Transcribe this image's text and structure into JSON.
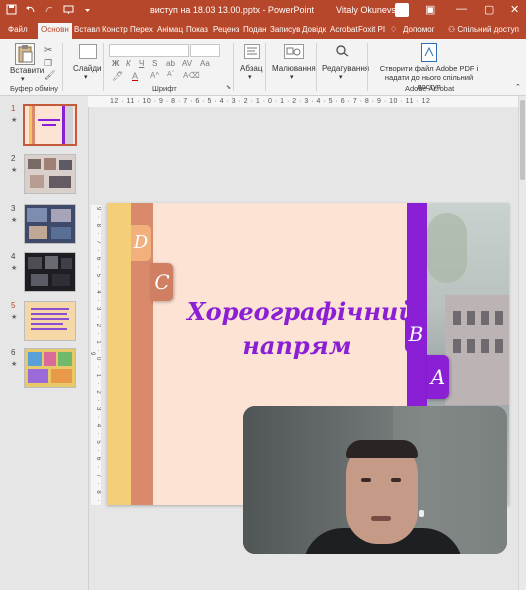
{
  "titlebar": {
    "document_title": "виступ на 18.03 13.00.pptx  -  PowerPoint",
    "user_name": "Vitaly Okunevsky"
  },
  "tabs": [
    "Файл",
    "Основн",
    "Вставл",
    "Констр",
    "Перех",
    "Анімац",
    "Показ",
    "Реценз",
    "Подан",
    "Записув",
    "Довідк",
    "Acrobat",
    "Foxit PI",
    "Допомог"
  ],
  "share": "Спільний доступ",
  "ribbon": {
    "paste": "Вставити",
    "clipboard_group": "Буфер обміну",
    "slides": "Слайди",
    "font_group": "Шрифт",
    "paragraph": "Абзац",
    "drawing": "Малювання",
    "editing": "Редагування",
    "acrobat_action_line1": "Створити файл Adobe PDF і",
    "acrobat_action_line2": "надати до нього спільний доступ",
    "acrobat_group": "Adobe Acrobat"
  },
  "ruler": {
    "top": "12 · 11 · 10 · 9 · 8 · 7 · 6 · 5 · 4 · 3 · 2 · 1 · 0 · 1 · 2 · 3 · 4 · 5 · 6 · 7 · 8 · 9 · 10 · 11 · 12",
    "left": "9 · 8 · 7 · 6 · 5 · 4 · 3 · 2 · 1 · 0 · 1 · 2 · 3 · 4 · 5 · 6 · 7 · 8 · 9"
  },
  "thumbnails": [
    {
      "num": "1",
      "selected": true
    },
    {
      "num": "2",
      "selected": false
    },
    {
      "num": "3",
      "selected": false
    },
    {
      "num": "4",
      "selected": false
    },
    {
      "num": "5",
      "selected": false
    },
    {
      "num": "6",
      "selected": false
    }
  ],
  "slide": {
    "title_line1": "Хореографічний",
    "title_line2": "напрям",
    "tab_letter_c": "C",
    "tab_letter_v": "B",
    "tab_letter_a": "A",
    "tab_letter_d": "D",
    "title_color": "#8a1fd6"
  },
  "colors": {
    "accent": "#b7472a",
    "slide_bg": "#fde3d4",
    "purple": "#8a1fd6"
  }
}
